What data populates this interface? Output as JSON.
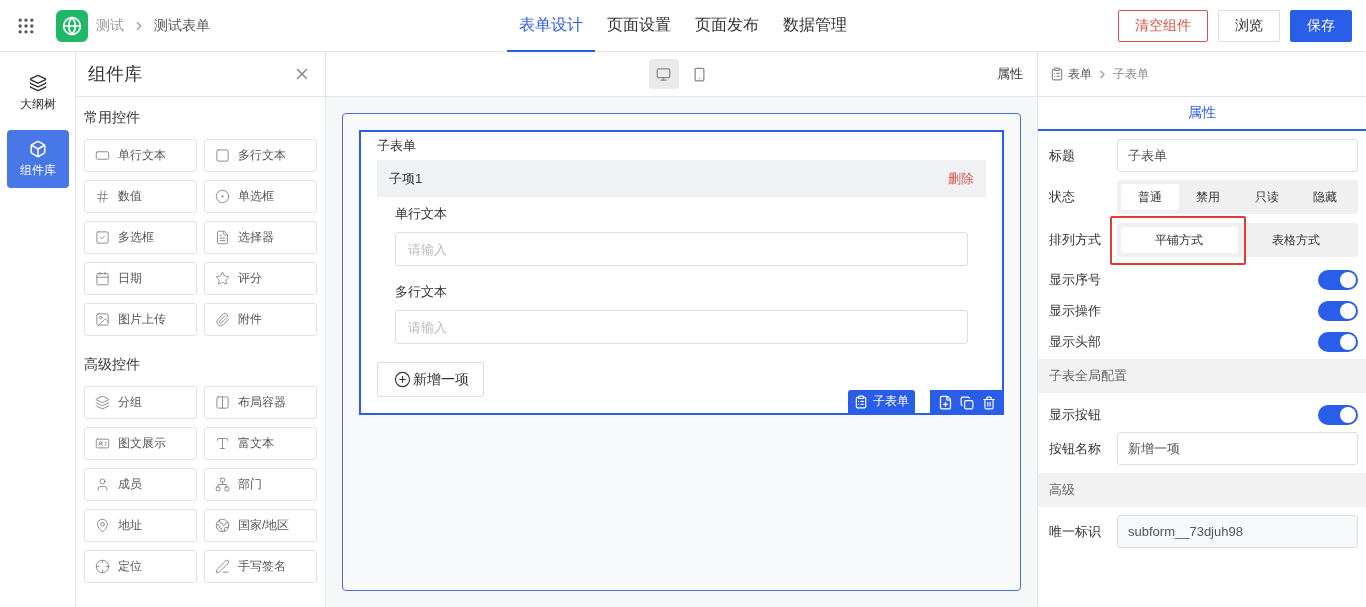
{
  "header": {
    "breadcrumb": [
      "测试",
      "测试表单"
    ],
    "tabs": [
      {
        "label": "表单设计",
        "selected": true
      },
      {
        "label": "页面设置",
        "selected": false
      },
      {
        "label": "页面发布",
        "selected": false
      },
      {
        "label": "数据管理",
        "selected": false
      }
    ],
    "buttons": [
      {
        "label": "清空组件",
        "kind": "danger"
      },
      {
        "label": "浏览",
        "kind": "default"
      },
      {
        "label": "保存",
        "kind": "primary"
      }
    ]
  },
  "rail": [
    {
      "label": "大纲树",
      "selected": false
    },
    {
      "label": "组件库",
      "selected": true
    }
  ],
  "library": {
    "title": "组件库",
    "groups": [
      {
        "title": "常用控件",
        "items": [
          "单行文本",
          "多行文本",
          "数值",
          "单选框",
          "多选框",
          "选择器",
          "日期",
          "评分",
          "图片上传",
          "附件"
        ]
      },
      {
        "title": "高级控件",
        "items": [
          "分组",
          "布局容器",
          "图文展示",
          "富文本",
          "成员",
          "部门",
          "地址",
          "国家/地区",
          "定位",
          "手写签名"
        ]
      }
    ]
  },
  "canvas": {
    "devices": [
      {
        "kind": "desktop",
        "selected": true
      },
      {
        "kind": "mobile",
        "selected": false
      }
    ],
    "panel_toggle": "属性",
    "subform": {
      "title": "子表单",
      "item_title": "子项1",
      "delete": "删除",
      "fields": [
        {
          "label": "单行文本",
          "placeholder": "请输入"
        },
        {
          "label": "多行文本",
          "placeholder": "请输入"
        }
      ],
      "add_button": "新增一项",
      "tag": "子表单"
    }
  },
  "props": {
    "breadcrumb": [
      "表单",
      "子表单"
    ],
    "tab": "属性",
    "title_label": "标题",
    "title_value": "子表单",
    "status_label": "状态",
    "status_options": [
      {
        "label": "普通",
        "selected": true
      },
      {
        "label": "禁用",
        "selected": false
      },
      {
        "label": "只读",
        "selected": false
      },
      {
        "label": "隐藏",
        "selected": false
      }
    ],
    "layout_label": "排列方式",
    "layout_options": [
      {
        "label": "平铺方式",
        "selected": true,
        "highlighted": true
      },
      {
        "label": "表格方式",
        "selected": false,
        "highlighted": false
      }
    ],
    "switches": [
      {
        "label": "显示序号",
        "on": true
      },
      {
        "label": "显示操作",
        "on": true
      },
      {
        "label": "显示头部",
        "on": true
      }
    ],
    "global_section": "子表全局配置",
    "global_switches": [
      {
        "label": "显示按钮",
        "on": true
      }
    ],
    "button_name_label": "按钮名称",
    "button_name_value": "新增一项",
    "advanced_section": "高级",
    "id_label": "唯一标识",
    "id_value": "subform__73djuh98"
  }
}
